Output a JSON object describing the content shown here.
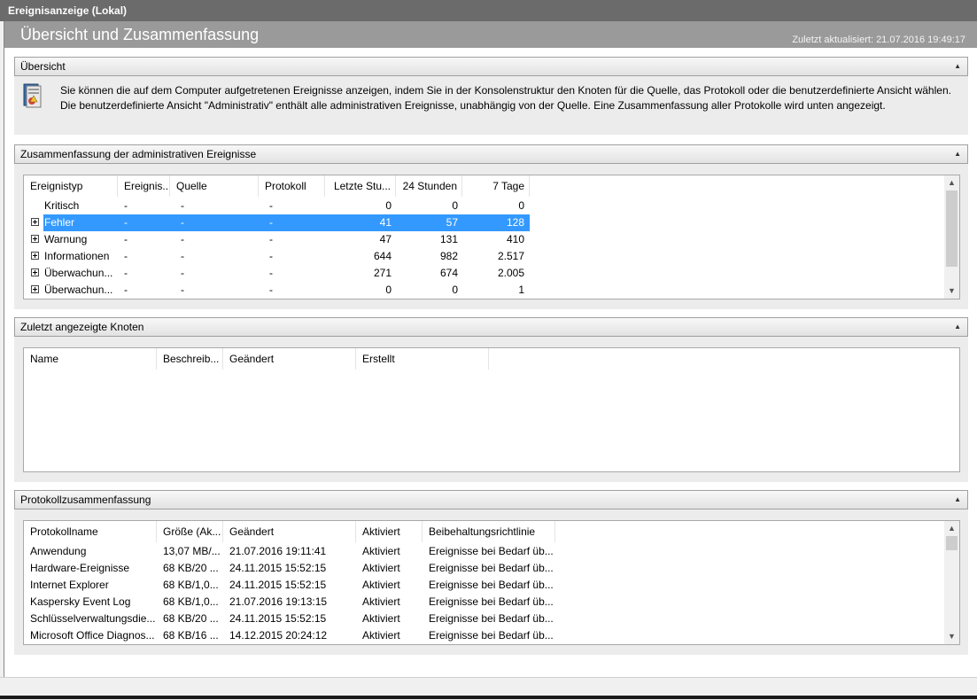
{
  "window": {
    "title": "Ereignisanzeige (Lokal)"
  },
  "header": {
    "title": "Übersicht und Zusammenfassung",
    "updated": "Zuletzt aktualisiert: 21.07.2016 19:49:17"
  },
  "overview": {
    "heading": "Übersicht",
    "icon": "event-log-icon",
    "line1": "Sie können die auf dem Computer aufgetretenen Ereignisse anzeigen, indem Sie in der Konsolenstruktur den Knoten für die Quelle, das Protokoll oder die benutzerdefinierte Ansicht wählen.",
    "line2": "Die benutzerdefinierte Ansicht \"Administrativ\" enthält alle administrativen Ereignisse, unabhängig von der Quelle. Eine Zusammenfassung aller Protokolle wird unten angezeigt."
  },
  "admin_summary": {
    "heading": "Zusammenfassung der administrativen Ereignisse",
    "columns": [
      "Ereignistyp",
      "Ereignis...",
      "Quelle",
      "Protokoll",
      "Letzte Stu...",
      "24 Stunden",
      "7 Tage"
    ],
    "rows": [
      {
        "type": "Kritisch",
        "id": "-",
        "source": "-",
        "log": "-",
        "last_hour": "0",
        "h24": "0",
        "d7": "0",
        "expandable": false
      },
      {
        "type": "Fehler",
        "id": "-",
        "source": "-",
        "log": "-",
        "last_hour": "41",
        "h24": "57",
        "d7": "128",
        "expandable": true,
        "selected": true
      },
      {
        "type": "Warnung",
        "id": "-",
        "source": "-",
        "log": "-",
        "last_hour": "47",
        "h24": "131",
        "d7": "410",
        "expandable": true
      },
      {
        "type": "Informationen",
        "id": "-",
        "source": "-",
        "log": "-",
        "last_hour": "644",
        "h24": "982",
        "d7": "2.517",
        "expandable": true
      },
      {
        "type": "Überwachun...",
        "id": "-",
        "source": "-",
        "log": "-",
        "last_hour": "271",
        "h24": "674",
        "d7": "2.005",
        "expandable": true
      },
      {
        "type": "Überwachun...",
        "id": "-",
        "source": "-",
        "log": "-",
        "last_hour": "0",
        "h24": "0",
        "d7": "1",
        "expandable": true
      }
    ]
  },
  "recent_nodes": {
    "heading": "Zuletzt angezeigte Knoten",
    "columns": [
      "Name",
      "Beschreib...",
      "Geändert",
      "Erstellt"
    ]
  },
  "log_summary": {
    "heading": "Protokollzusammenfassung",
    "columns": [
      "Protokollname",
      "Größe (Ak...",
      "Geändert",
      "Aktiviert",
      "Beibehaltungsrichtlinie"
    ],
    "rows": [
      {
        "name": "Anwendung",
        "size": "13,07 MB/...",
        "changed": "21.07.2016 19:11:41",
        "enabled": "Aktiviert",
        "policy": "Ereignisse bei Bedarf üb..."
      },
      {
        "name": "Hardware-Ereignisse",
        "size": "68 KB/20 ...",
        "changed": "24.11.2015 15:52:15",
        "enabled": "Aktiviert",
        "policy": "Ereignisse bei Bedarf üb..."
      },
      {
        "name": "Internet Explorer",
        "size": "68 KB/1,0...",
        "changed": "24.11.2015 15:52:15",
        "enabled": "Aktiviert",
        "policy": "Ereignisse bei Bedarf üb..."
      },
      {
        "name": "Kaspersky Event Log",
        "size": "68 KB/1,0...",
        "changed": "21.07.2016 19:13:15",
        "enabled": "Aktiviert",
        "policy": "Ereignisse bei Bedarf üb..."
      },
      {
        "name": "Schlüsselverwaltungsdie...",
        "size": "68 KB/20 ...",
        "changed": "24.11.2015 15:52:15",
        "enabled": "Aktiviert",
        "policy": "Ereignisse bei Bedarf üb..."
      },
      {
        "name": "Microsoft Office Diagnos...",
        "size": "68 KB/16 ...",
        "changed": "14.12.2015 20:24:12",
        "enabled": "Aktiviert",
        "policy": "Ereignisse bei Bedarf üb..."
      }
    ]
  },
  "colors": {
    "selection": "#3399ff",
    "header": "#9a9a9a",
    "titlebar": "#6b6b6b"
  }
}
